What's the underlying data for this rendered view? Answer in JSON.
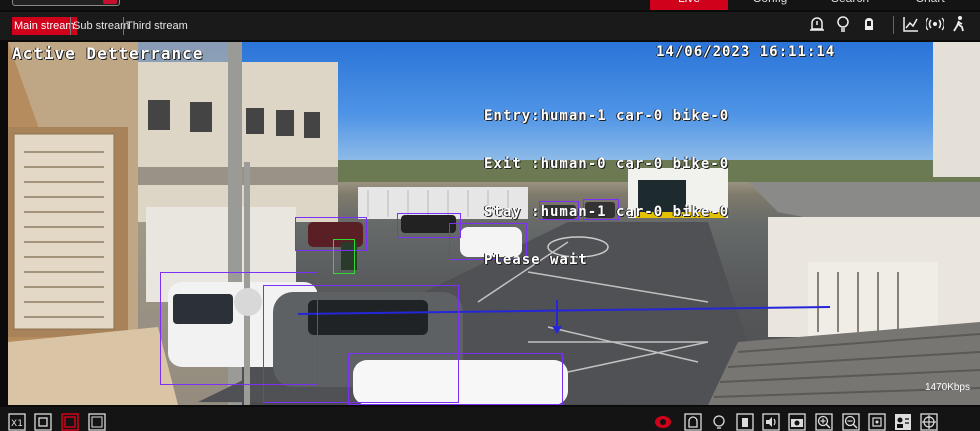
{
  "top_nav": {
    "tabs": [
      {
        "label": "Live"
      },
      {
        "label": "Config"
      },
      {
        "label": "Search"
      },
      {
        "label": "Chart"
      }
    ]
  },
  "streams": {
    "tabs": [
      {
        "label": "Main stream"
      },
      {
        "label": "Sub stream"
      },
      {
        "label": "Third stream"
      }
    ]
  },
  "toolbar_icons": [
    "alarm-icon",
    "light-icon",
    "audio-alert-icon",
    "statistics-icon",
    "radio-icon",
    "person-walk-icon"
  ],
  "video": {
    "mode_label": "Active Detterrance",
    "timestamp": "14/06/2023 16:11:14",
    "counters": {
      "line1": "Entry:human-1 car-0 bike-0",
      "line2": "Exit :human-0 car-0 bike-0",
      "line3": "Stay :human-1 car-0 bike-0",
      "line4": "Please wait"
    },
    "bitrate": "1470Kbps"
  },
  "bottom_left_icons": [
    "fit-window-icon",
    "original-size-icon",
    "stretch-icon",
    "fullscreen-icon"
  ],
  "bottom_right_icons": [
    "record-icon",
    "alarm-output-icon",
    "light-control-icon",
    "siren-icon",
    "audio-icon",
    "snapshot-icon",
    "zoom-in-icon",
    "zoom-out-icon",
    "3d-position-icon",
    "face-info-icon",
    "ptz-icon"
  ],
  "colors": {
    "accent": "#d0021b",
    "detection_box": "#7b2ff7",
    "detection_person": "#2ed82e",
    "crossing_line": "#2626d9"
  }
}
